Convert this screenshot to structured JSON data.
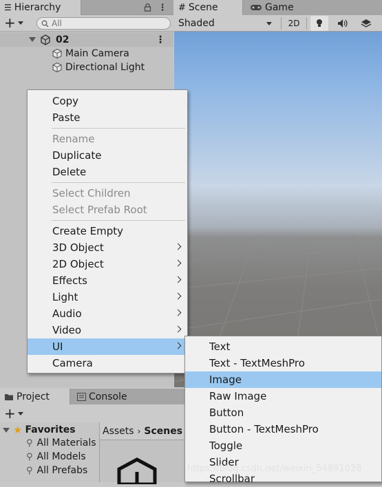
{
  "hierarchy": {
    "tab_label": "Hierarchy",
    "search_placeholder": "All",
    "scene_name": "02",
    "objects": [
      "Main Camera",
      "Directional Light"
    ]
  },
  "scene_view": {
    "tab_scene": "Scene",
    "tab_game": "Game",
    "shading_mode": "Shaded",
    "mode_2d": "2D"
  },
  "project": {
    "tab_project": "Project",
    "tab_console": "Console",
    "favorites_label": "Favorites",
    "favorites": [
      "All Materials",
      "All Models",
      "All Prefabs"
    ],
    "breadcrumb_root": "Assets",
    "breadcrumb_current": "Scenes"
  },
  "context_menu": {
    "copy": "Copy",
    "paste": "Paste",
    "rename": "Rename",
    "duplicate": "Duplicate",
    "delete": "Delete",
    "select_children": "Select Children",
    "select_prefab_root": "Select Prefab Root",
    "create_empty": "Create Empty",
    "object_3d": "3D Object",
    "object_2d": "2D Object",
    "effects": "Effects",
    "light": "Light",
    "audio": "Audio",
    "video": "Video",
    "ui": "UI",
    "camera": "Camera"
  },
  "ui_submenu": {
    "text": "Text",
    "text_tmp": "Text - TextMeshPro",
    "image": "Image",
    "raw_image": "Raw Image",
    "button": "Button",
    "button_tmp": "Button - TextMeshPro",
    "toggle": "Toggle",
    "slider": "Slider",
    "scrollbar": "Scrollbar"
  },
  "watermark": "https://blog.csdn.net/weixin_54891028",
  "colors": {
    "highlight": "#9ac8f0",
    "menu_bg": "#f0f0f0",
    "panel_bg": "#c2c2c2",
    "disabled_text": "#8a8a8a"
  }
}
